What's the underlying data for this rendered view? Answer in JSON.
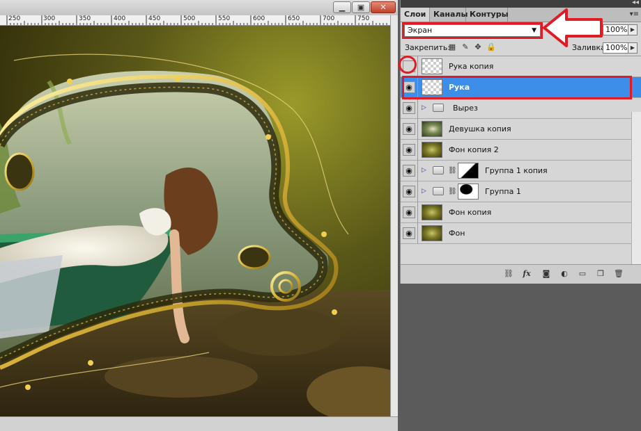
{
  "ruler": {
    "labels": [
      "250",
      "300",
      "350",
      "400",
      "450",
      "500",
      "550",
      "600",
      "650",
      "700",
      "750"
    ]
  },
  "tabs": {
    "layers": "Слои",
    "channels": "Каналы",
    "paths": "Контуры"
  },
  "blend_mode": "Экран",
  "opacity": "100%",
  "lock_label": "Закрепить:",
  "fill_label": "Заливка:",
  "fill": "100%",
  "layers": [
    {
      "name": "Рука копия",
      "visible": false,
      "thumb": "transparent"
    },
    {
      "name": "Рука",
      "visible": true,
      "selected": true,
      "thumb": "transparent"
    },
    {
      "name": "Вырез",
      "visible": true,
      "group": true
    },
    {
      "name": "Девушка копия",
      "visible": true,
      "thumb": "girl"
    },
    {
      "name": "Фон копия 2",
      "visible": true,
      "thumb": "olive"
    },
    {
      "name": "Группа 1 копия",
      "visible": true,
      "group": true,
      "mask": "mask1"
    },
    {
      "name": "Группа 1",
      "visible": true,
      "group": true,
      "mask": "mask2"
    },
    {
      "name": "Фон копия",
      "visible": true,
      "thumb": "olive"
    },
    {
      "name": "Фон",
      "visible": true,
      "thumb": "olive"
    }
  ],
  "colors": {
    "highlight": "#e01b24",
    "selection": "#3d8ee8"
  }
}
